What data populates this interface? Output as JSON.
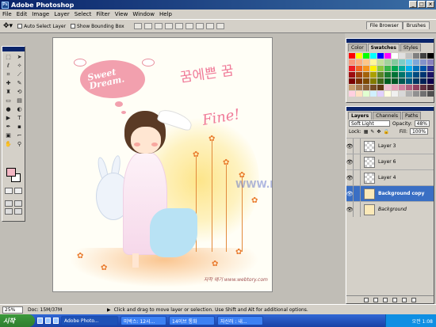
{
  "app": {
    "title": "Adobe Photoshop"
  },
  "menu": [
    "File",
    "Edit",
    "Image",
    "Layer",
    "Select",
    "Filter",
    "View",
    "Window",
    "Help"
  ],
  "options": {
    "auto_select": "Auto Select Layer",
    "show_bounding": "Show Bounding Box",
    "palette_well_tabs": [
      "File Browser",
      "Brushes"
    ]
  },
  "artwork": {
    "bubble_text": "Sweet Dream.",
    "korean_title": "꿈에쁜 꿈",
    "fine_text": "Fine!",
    "signature": "저작 애기 www.webtory.com",
    "watermark": "WWW.LOTOO.COM"
  },
  "swatches_panel": {
    "tabs": [
      "Color",
      "Swatches",
      "Styles"
    ],
    "active_tab": "Swatches",
    "colors": [
      "#ff0000",
      "#ffff00",
      "#00ff00",
      "#00ffff",
      "#0000ff",
      "#ff00ff",
      "#ffffff",
      "#e0e0e0",
      "#c0c0c0",
      "#808080",
      "#404040",
      "#000000",
      "#f7977a",
      "#f9ad81",
      "#fdc68a",
      "#fff79a",
      "#c4df9b",
      "#a2d39c",
      "#82ca9d",
      "#7bcdc8",
      "#6ecff6",
      "#7ea7d8",
      "#8493ca",
      "#8882be",
      "#ed1c24",
      "#f26522",
      "#f7941d",
      "#fff200",
      "#8dc63f",
      "#39b54a",
      "#00a651",
      "#00a99d",
      "#00aeef",
      "#0072bc",
      "#0054a6",
      "#2e3192",
      "#9e0b0f",
      "#a0410d",
      "#a3620a",
      "#aba000",
      "#598527",
      "#1a7b30",
      "#007236",
      "#00746b",
      "#0076a3",
      "#004b80",
      "#003471",
      "#1b1464",
      "#790000",
      "#7b2e00",
      "#7d4900",
      "#827b00",
      "#406618",
      "#005e20",
      "#005826",
      "#005952",
      "#005b7f",
      "#003663",
      "#002157",
      "#0d004c",
      "#c69c6d",
      "#a67c52",
      "#8c6239",
      "#754c24",
      "#603913",
      "#f0c0d0",
      "#e8a0b8",
      "#d080a0",
      "#b06080",
      "#904060",
      "#603040",
      "#402030",
      "#ffd0e0",
      "#ffe0c0",
      "#e0ffd0",
      "#d0f0ff",
      "#e0d0ff",
      "#ffffe0",
      "#f0f0f0",
      "#d8d8d8",
      "#b0b0b0",
      "#909090",
      "#707070",
      "#505050"
    ]
  },
  "layers_panel": {
    "tabs": [
      "Layers",
      "Channels",
      "Paths"
    ],
    "active_tab": "Layers",
    "blend_mode": "Soft Light",
    "opacity_label": "Opacity:",
    "opacity": "48%",
    "lock_label": "Lock:",
    "fill_label": "Fill:",
    "fill": "100%",
    "layers": [
      {
        "name": "Layer 3",
        "active": false,
        "italic": false,
        "image": false
      },
      {
        "name": "Layer 6",
        "active": false,
        "italic": false,
        "image": false
      },
      {
        "name": "Layer 4",
        "active": false,
        "italic": false,
        "image": false
      },
      {
        "name": "Background copy",
        "active": true,
        "italic": false,
        "image": true
      },
      {
        "name": "Background",
        "active": false,
        "italic": true,
        "image": true
      }
    ]
  },
  "status": {
    "zoom": "25%",
    "doc": "Doc: 15M/37M",
    "hint": "Click and drag to move layer or selection. Use Shift and Alt for additional options."
  },
  "taskbar": {
    "start": "시작",
    "tasks": [
      "Adobe Photo...",
      "미박스: 12시...",
      "14이브 통화",
      "자신러 : 내..."
    ],
    "clock": "오전 1:08"
  }
}
